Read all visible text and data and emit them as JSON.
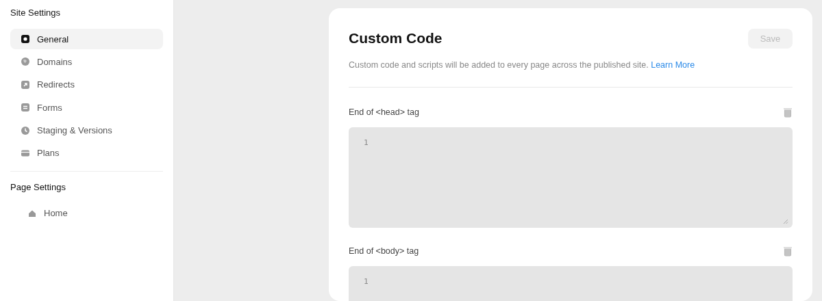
{
  "sidebar": {
    "sections": [
      {
        "title": "Site Settings",
        "items": [
          {
            "label": "General",
            "kind": "gear",
            "selected": true
          },
          {
            "label": "Domains",
            "kind": "globe",
            "selected": false
          },
          {
            "label": "Redirects",
            "kind": "redirect",
            "selected": false
          },
          {
            "label": "Forms",
            "kind": "form",
            "selected": false
          },
          {
            "label": "Staging & Versions",
            "kind": "clock",
            "selected": false
          },
          {
            "label": "Plans",
            "kind": "card",
            "selected": false
          }
        ]
      },
      {
        "title": "Page Settings",
        "items": [
          {
            "label": "Home",
            "kind": "home",
            "selected": false
          }
        ]
      }
    ]
  },
  "panel": {
    "title": "Custom Code",
    "save_button": {
      "label": "Save",
      "disabled": true
    },
    "description": "Custom code and scripts will be added to every page across the published site.",
    "link": "Learn More",
    "editors": [
      {
        "label": "End of <head> tag",
        "line_number": "1"
      },
      {
        "label": "End of <body> tag",
        "line_number": "1"
      }
    ]
  }
}
